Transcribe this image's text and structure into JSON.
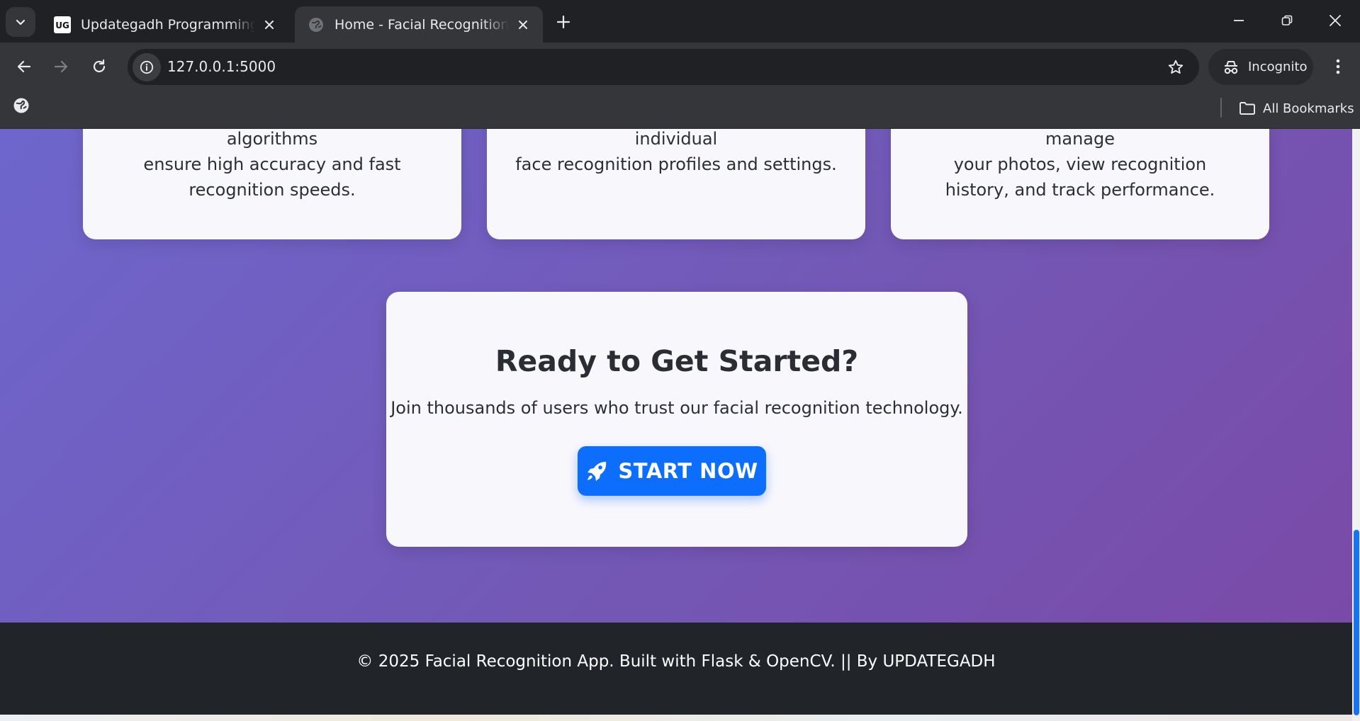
{
  "browser": {
    "tabs": [
      {
        "title": "Updategadh Programming - Updategadh",
        "favicon": "ug-logo-icon",
        "active": false
      },
      {
        "title": "Home - Facial Recognition App",
        "favicon": "globe-icon",
        "active": true
      }
    ],
    "address": "127.0.0.1:5000",
    "profile_label": "Incognito",
    "bookmarks_label": "All Bookmarks",
    "favicon_text": "UG"
  },
  "features": [
    {
      "line_partial": "Advanced machine learning algorithms",
      "text": "ensure high accuracy and fast recognition speeds."
    },
    {
      "line_partial": "Support for multiple users with individual",
      "text": "face recognition profiles and settings."
    },
    {
      "line_partial": "Comprehensive dashboard to manage",
      "text": "your photos, view recognition history, and track performance."
    }
  ],
  "cta": {
    "heading": "Ready to Get Started?",
    "subtext": "Join thousands of users who trust our facial recognition technology.",
    "button_label": "START NOW",
    "button_icon": "rocket-icon",
    "button_color": "#0d6efd"
  },
  "footer": {
    "text": "© 2025 Facial Recognition App. Built with Flask & OpenCV. || By UPDATEGADH"
  },
  "colors": {
    "hero_gradient_start": "#6e66cc",
    "hero_gradient_end": "#7a4aa8",
    "footer_bg": "#212529",
    "card_bg": "#f8f7fc"
  }
}
